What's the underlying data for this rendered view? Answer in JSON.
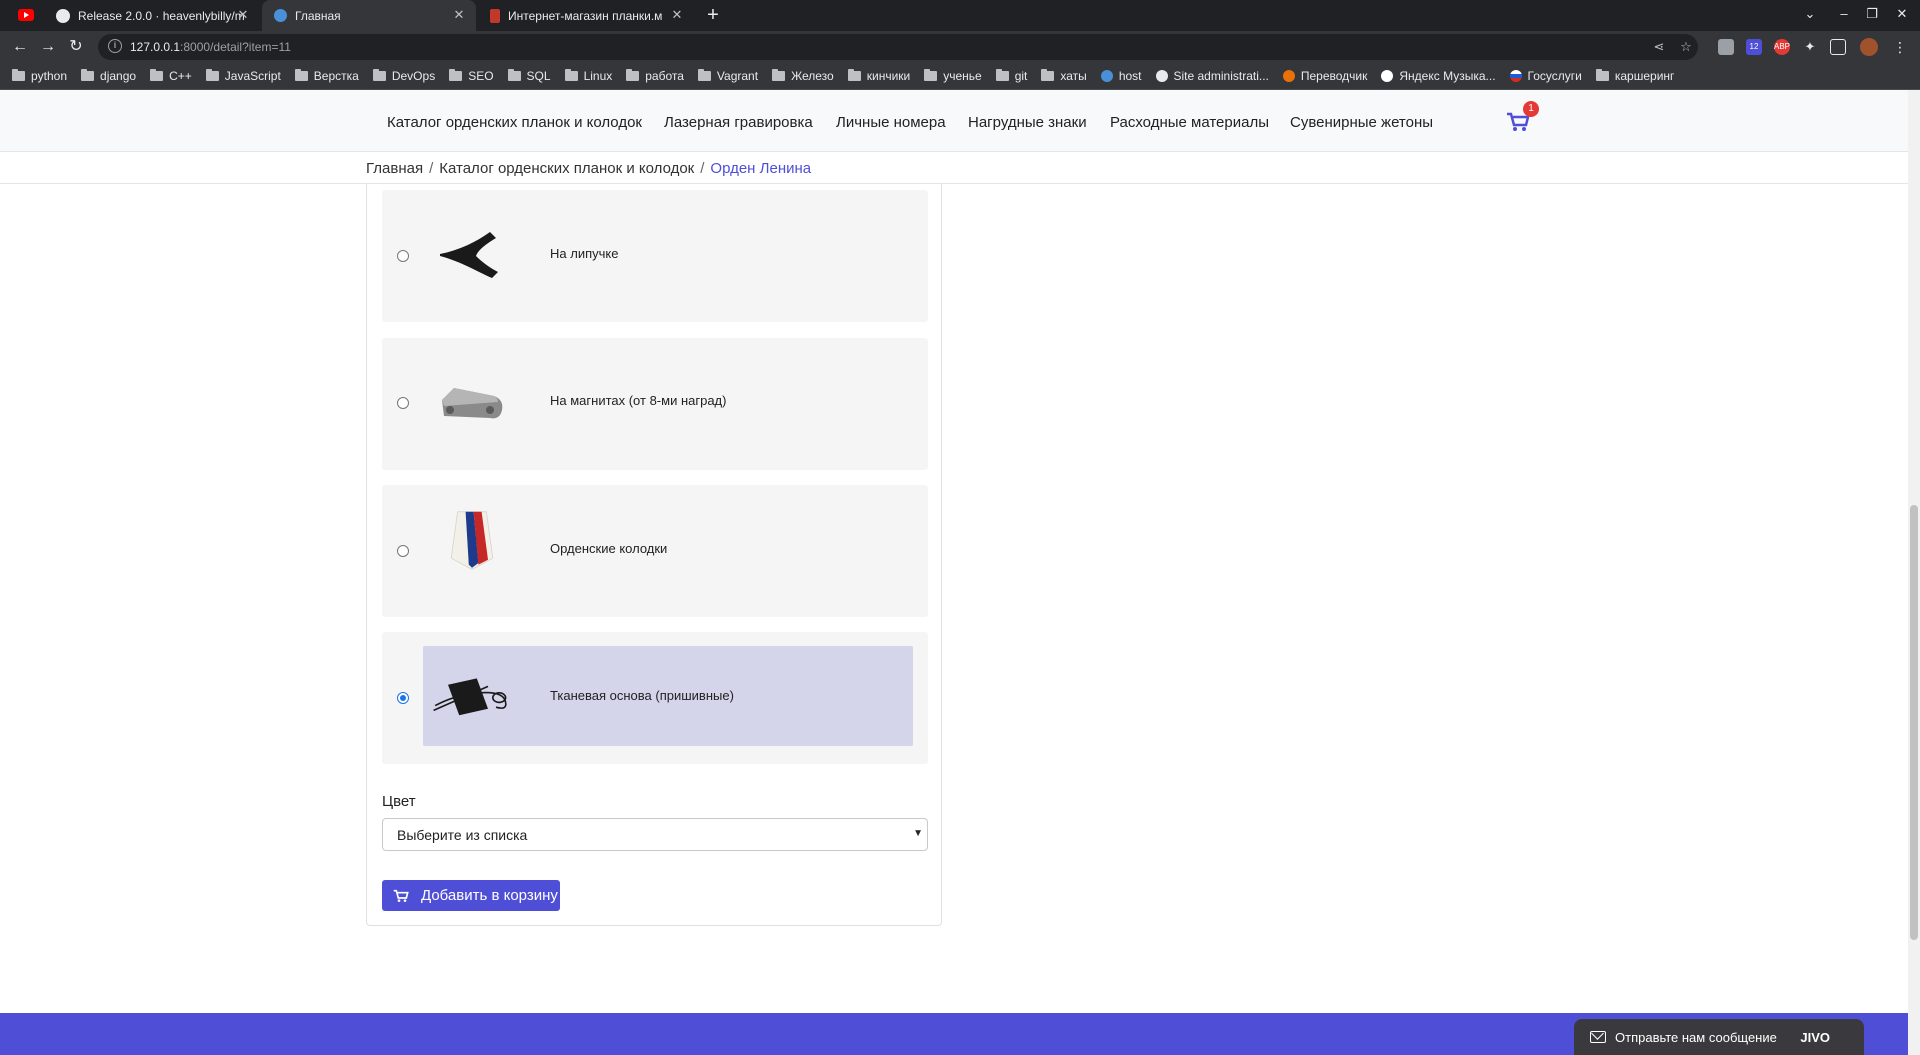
{
  "browser": {
    "tabs": [
      {
        "title": "Release 2.0.0 · heavenlybilly/m"
      },
      {
        "title": "Главная"
      },
      {
        "title": "Интернет-магазин планки.м"
      }
    ],
    "address": {
      "host": "127.0.0.1",
      "rest": ":8000/detail?item=11"
    },
    "ext_badge": "12",
    "ext_abp": "ABP",
    "bookmarks": [
      "python",
      "django",
      "C++",
      "JavaScript",
      "Верстка",
      "DevOps",
      "SEO",
      "SQL",
      "Linux",
      "работа",
      "Vagrant",
      "Железо",
      "кинчики",
      "ученье",
      "git",
      "хаты",
      "host",
      "Site administrati...",
      "Переводчик",
      "Яндекс Музыка...",
      "Госуслуги",
      "каршеринг"
    ]
  },
  "nav": {
    "items": [
      "Каталог орденских планок и колодок",
      "Лазерная гравировка",
      "Личные номера",
      "Нагрудные знаки",
      "Расходные материалы",
      "Сувенирные жетоны"
    ],
    "cart_count": "1"
  },
  "breadcrumb": {
    "items": [
      "Главная",
      "Каталог орденских планок и колодок"
    ],
    "separator": "/",
    "current": "Орден Ленина"
  },
  "options": [
    {
      "label": "На липучке",
      "selected": false
    },
    {
      "label": "На магнитах (от 8-ми наград)",
      "selected": false
    },
    {
      "label": "Орденские колодки",
      "selected": false
    },
    {
      "label": "Тканевая основа (пришивные)",
      "selected": true
    }
  ],
  "color": {
    "label": "Цвет",
    "select_value": "Выберите из списка"
  },
  "add_to_cart": "Добавить в корзину",
  "chat": {
    "label": "Отправьте нам сообщение",
    "brand": "JIVO"
  },
  "colors": {
    "accent": "#4e4fd6",
    "selected_bg": "#d4d5ea",
    "option_bg": "#f5f5f5"
  }
}
